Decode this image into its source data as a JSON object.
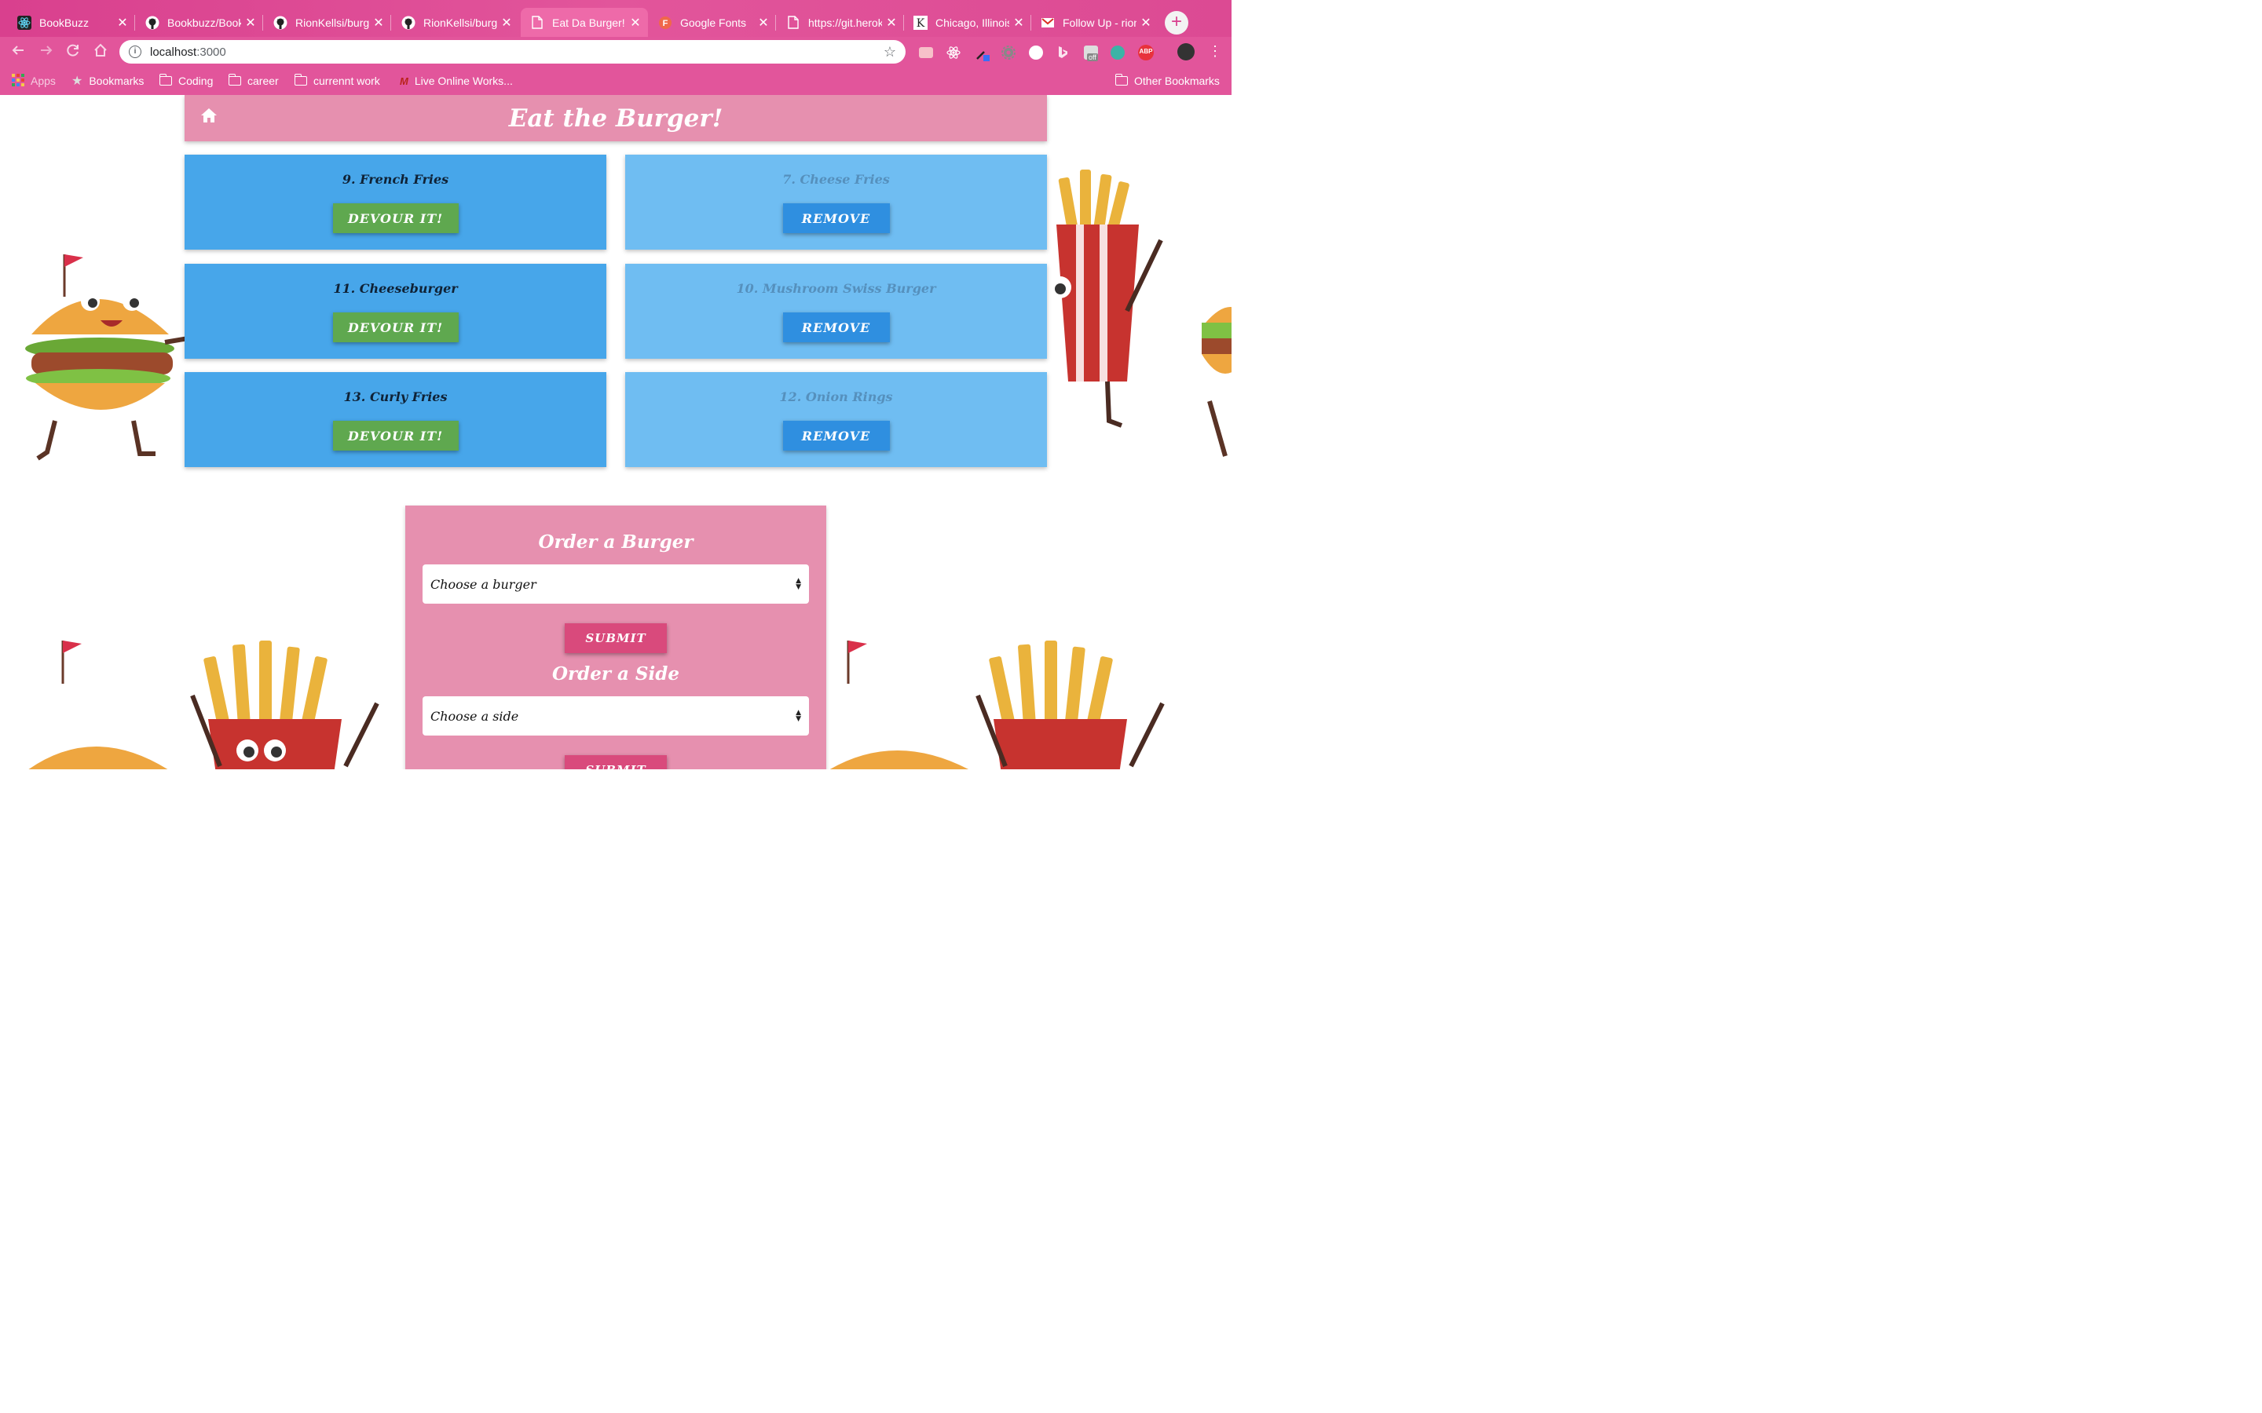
{
  "browser": {
    "tabs": [
      {
        "title": "BookBuzz",
        "icon": "react-icon"
      },
      {
        "title": "Bookbuzz/BookBuzz",
        "icon": "github-icon"
      },
      {
        "title": "RionKellsi/burger",
        "icon": "github-icon"
      },
      {
        "title": "RionKellsi/burger",
        "icon": "github-icon"
      },
      {
        "title": "Eat Da Burger!",
        "icon": "page-icon",
        "active": true
      },
      {
        "title": "Google Fonts",
        "icon": "google-fonts-icon"
      },
      {
        "title": "https://git.heroku",
        "icon": "page-icon"
      },
      {
        "title": "Chicago, Illinois",
        "icon": "k-icon"
      },
      {
        "title": "Follow Up - rion",
        "icon": "gmail-icon"
      }
    ],
    "close_glyph": "✕",
    "new_tab_glyph": "+",
    "url_host": "localhost",
    "url_port": ":3000",
    "bookmarks": [
      {
        "label": "Apps",
        "icon": "apps-grid-icon"
      },
      {
        "label": "Bookmarks",
        "icon": "star-icon"
      },
      {
        "label": "Coding",
        "icon": "folder-icon"
      },
      {
        "label": "career",
        "icon": "folder-icon"
      },
      {
        "label": "currennt work",
        "icon": "folder-icon"
      },
      {
        "label": "Live Online Works...",
        "icon": "site-icon"
      }
    ],
    "other_bookmarks": "Other Bookmarks",
    "extension_badge": "off"
  },
  "page": {
    "title": "Eat the Burger!",
    "todo_items": [
      {
        "name": "9. French Fries",
        "button": "DEVOUR IT!"
      },
      {
        "name": "11. Cheeseburger",
        "button": "DEVOUR IT!"
      },
      {
        "name": "13. Curly Fries",
        "button": "DEVOUR IT!"
      }
    ],
    "devoured_items": [
      {
        "name": "7. Cheese Fries",
        "button": "REMOVE"
      },
      {
        "name": "10. Mushroom Swiss Burger",
        "button": "REMOVE"
      },
      {
        "name": "12. Onion Rings",
        "button": "REMOVE"
      }
    ],
    "order_burger": {
      "heading": "Order a Burger",
      "select_value": "Choose a burger",
      "submit": "SUBMIT"
    },
    "order_side": {
      "heading": "Order a Side",
      "select_value": "Choose a side",
      "submit": "SUBMIT"
    }
  },
  "colors": {
    "chrome_pink": "#e2559b",
    "header_pink": "#e690af",
    "todo_blue": "#47a6ea",
    "done_blue": "#6fbdf2",
    "devour_green": "#5fa84f",
    "remove_blue": "#2f8fe0",
    "submit_pink": "#d94a7c"
  }
}
